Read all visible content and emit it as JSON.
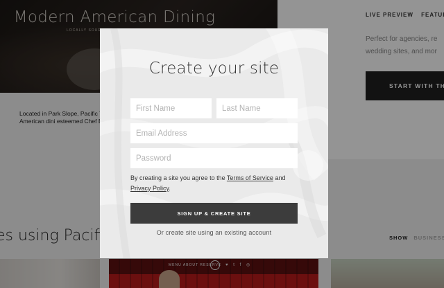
{
  "background": {
    "hero": {
      "title": "Modern American Dining",
      "tagline": "LOCALLY SOURCED",
      "description": "Located in Park Slope, Pacific T purveyor of fine American dini esteemed Chef Billy Lang."
    },
    "right_panel": {
      "nav": [
        "LIVE PREVIEW",
        "FEATURE H"
      ],
      "description": "Perfect for agencies, re wedding sites, and mor",
      "start_button": "START WITH THI"
    },
    "section": {
      "heading": "es using Pacific",
      "filters": [
        "SHOW",
        "BUSINESSE"
      ]
    },
    "thumbnail_nav": "MENU   ABOUT   RESERVE",
    "thumbnail_social": "♥ t f ◎"
  },
  "modal": {
    "title": "Create your site",
    "fields": {
      "first_name_placeholder": "First Name",
      "last_name_placeholder": "Last Name",
      "email_placeholder": "Email Address",
      "password_placeholder": "Password"
    },
    "terms": {
      "prefix": "By creating a site you agree to the ",
      "tos_link": "Terms of Service",
      "middle": " and ",
      "privacy_link": "Privacy Policy",
      "suffix": "."
    },
    "signup_button": "SIGN UP & CREATE SITE",
    "alt_link": "Or create site using an existing account"
  },
  "colors": {
    "overlay": "rgba(0,0,0,0.42)",
    "modal_bg": "#eaeaea",
    "button": "#3c3c3c",
    "dark_button": "#1f1f1f",
    "thumb_red": "#b81b1b"
  }
}
